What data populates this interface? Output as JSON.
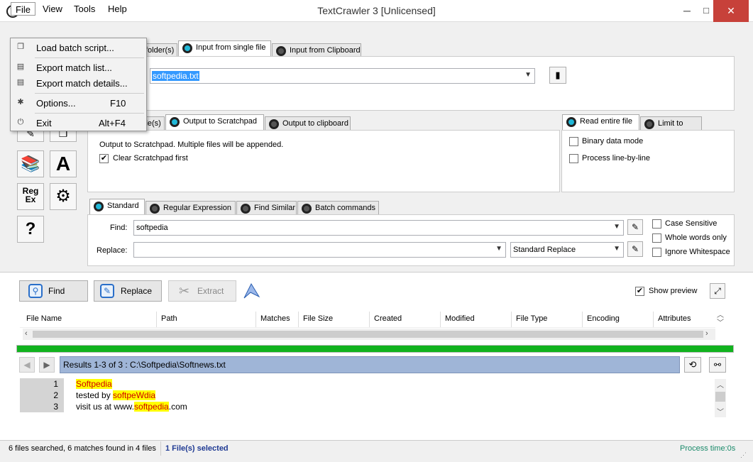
{
  "window": {
    "title": "TextCrawler 3 [Unlicensed]",
    "icon_letter": "T",
    "minimize": "─",
    "maximize": "□",
    "close": "✕"
  },
  "menu": {
    "file": "File",
    "view": "View",
    "tools": "Tools",
    "help": "Help"
  },
  "file_menu": {
    "load_batch": "Load batch script...",
    "export_match_list": "Export match list...",
    "export_match_details": "Export match details...",
    "options": "Options...",
    "options_shortcut": "F10",
    "exit": "Exit",
    "exit_shortcut": "Alt+F4"
  },
  "input_tabs": {
    "folders": "folder(s)",
    "single_file": "Input from single file",
    "clipboard": "Input from Clipboard"
  },
  "input_file": {
    "value": "softpedia.txt"
  },
  "output_tabs": {
    "files": "ile(s)",
    "scratchpad": "Output to Scratchpad",
    "clipboard": "Output to clipboard"
  },
  "output_panel": {
    "description": "Output to Scratchpad.  Multiple files will be appended.",
    "clear_label": "Clear Scratchpad first",
    "clear_checked": true
  },
  "read_tabs": {
    "entire": "Read entire file",
    "lines": "Limit to lines"
  },
  "read_panel": {
    "binary": "Binary data mode",
    "line_by_line": "Process line-by-line"
  },
  "search_tabs": {
    "standard": "Standard",
    "regex": "Regular Expression",
    "similar": "Find Similar",
    "batch": "Batch commands"
  },
  "search": {
    "find_label": "Find:",
    "find_value": "softpedia",
    "replace_label": "Replace:",
    "replace_value": "",
    "replace_mode": "Standard Replace",
    "case_sensitive": "Case Sensitive",
    "whole_words": "Whole words only",
    "ignore_ws": "Ignore Whitespace"
  },
  "sidebar": {
    "regex_line1": "Reg",
    "regex_line2": "Ex",
    "help": "?",
    "font": "A"
  },
  "actions": {
    "find": "Find",
    "replace": "Replace",
    "extract": "Extract",
    "show_preview": "Show preview",
    "show_preview_checked": true
  },
  "table": {
    "columns": [
      "File Name",
      "Path",
      "Matches",
      "File Size",
      "Created",
      "Modified",
      "File Type",
      "Encoding",
      "Attributes"
    ]
  },
  "progress": {
    "fraction": 1.0,
    "color": "#11b31e"
  },
  "results": {
    "label": "Results 1-3 of 3 : C:\\Softpedia\\Softnews.txt"
  },
  "preview": {
    "lines": [
      {
        "num": "1",
        "pre": "",
        "match": "Softpedia",
        "post": ""
      },
      {
        "num": "2",
        "pre": "tested by ",
        "match": "softpeWdia",
        "post": ""
      },
      {
        "num": "3",
        "pre": "visit us at www.",
        "match": "softpedia",
        "post": ".com"
      }
    ]
  },
  "status": {
    "summary": "6 files searched, 6 matches found in 4 files",
    "selected": "1 File(s) selected",
    "time": "Process time:0s"
  },
  "colors": {
    "accent": "#20b8d8",
    "close_red": "#c7413a",
    "results_bar": "#9fb5d7",
    "highlight": "#ffff00"
  }
}
